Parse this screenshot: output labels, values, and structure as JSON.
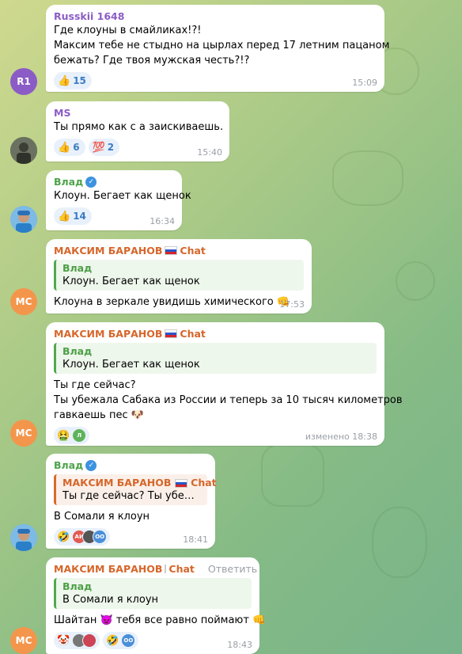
{
  "messages": [
    {
      "author": "Russkii 1648",
      "author_color": "#8b5cc6",
      "lines": [
        "Где клоуны в смайликах!?!",
        "Максим тебе не стыдно на цырлах перед 17 летним пацаном",
        "бежать? Где твоя мужская честь?!?"
      ],
      "reactions": [
        {
          "emoji": "👍",
          "count": "15"
        }
      ],
      "time": "15:09",
      "avatar_initials": "R1",
      "avatar_color": "#8b5cc6"
    },
    {
      "author": "MS",
      "author_color": "#8b5cc6",
      "lines": [
        "Ты прямо как с   а заискиваешь."
      ],
      "reactions": [
        {
          "emoji": "👍",
          "count": "6"
        },
        {
          "emoji": "💯",
          "count": "2"
        }
      ],
      "time": "15:40"
    },
    {
      "author": "Влад",
      "author_color": "#4ea34a",
      "lines": [
        "Клоун. Бегает как щенок"
      ],
      "reactions": [
        {
          "emoji": "👍",
          "count": "14"
        }
      ],
      "time": "16:34"
    },
    {
      "author": "МАКСИМ БАРАНОВ",
      "author_suffix": "Chat",
      "author_color": "#d6662a",
      "quote_author": "Влад",
      "quote_text": "Клоун. Бегает как щенок",
      "lines": [
        "Клоуна в зеркале увидишь химического 👊"
      ],
      "time": "17:53",
      "avatar_initials": "MC",
      "avatar_color": "#f3964c"
    },
    {
      "author": "МАКСИМ БАРАНОВ",
      "author_suffix": "Chat",
      "author_color": "#d6662a",
      "quote_author": "Влад",
      "quote_text": "Клоун. Бегает как щенок",
      "lines": [
        "Ты где сейчас?",
        "Ты убежала Сабака из России и теперь за 10 тысяч километров",
        "гавкаешь пес 🐶"
      ],
      "reactions": [
        {
          "emoji": "🤮"
        }
      ],
      "time": "изменено 18:38",
      "avatar_initials": "MC",
      "avatar_color": "#f3964c"
    },
    {
      "author": "Влад",
      "author_color": "#4ea34a",
      "quote_author": "МАКСИМ БАРАНОВ",
      "quote_suffix": "Chat",
      "quote_text": "Ты где сейчас? Ты убежала…",
      "lines": [
        "В Сомали я клоун"
      ],
      "reactions": [
        {
          "emoji": "🤣"
        }
      ],
      "react_avatars": [
        "АИ",
        "OO"
      ],
      "time": "18:41"
    },
    {
      "author": "МАКСИМ БАРАНОВ",
      "author_suffix": "Chat",
      "author_color": "#d6662a",
      "reply_label": "Ответить",
      "quote_author": "Влад",
      "quote_text": "В Сомали я клоун",
      "lines": [
        "Шайтан 👿 тебя все равно поймают 👊"
      ],
      "reactions": [
        {
          "emoji": "🤡"
        },
        {
          "emoji": "🤣"
        }
      ],
      "react_avatars_2": [
        "OO"
      ],
      "time": "18:43",
      "avatar_initials": "MC",
      "avatar_color": "#f3964c"
    }
  ]
}
